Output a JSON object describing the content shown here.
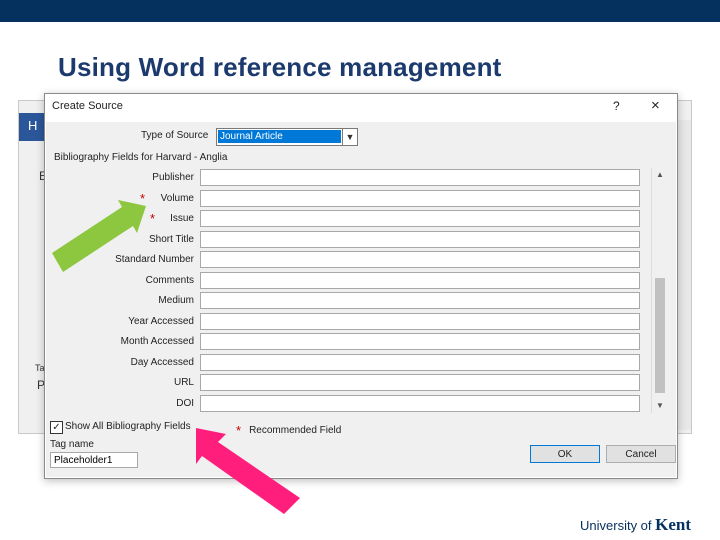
{
  "slide": {
    "title": "Using Word reference management",
    "logo_prefix": "University of",
    "logo_name": "Kent"
  },
  "background_window": {
    "tab_glyph": "H",
    "fragment_1": "E",
    "fragment_2": "P",
    "fragment_3": "Ta"
  },
  "dialog": {
    "title": "Create Source",
    "help": "?",
    "close": "×",
    "type_of_source_label": "Type of Source",
    "type_of_source_value": "Journal Article",
    "fields_heading": "Bibliography Fields for Harvard - Anglia",
    "fields": [
      {
        "label": "Publisher",
        "recommended": false
      },
      {
        "label": "Volume",
        "recommended": true
      },
      {
        "label": "Issue",
        "recommended": true
      },
      {
        "label": "Short Title",
        "recommended": false
      },
      {
        "label": "Standard Number",
        "recommended": false
      },
      {
        "label": "Comments",
        "recommended": false
      },
      {
        "label": "Medium",
        "recommended": false
      },
      {
        "label": "Year Accessed",
        "recommended": false
      },
      {
        "label": "Month Accessed",
        "recommended": false
      },
      {
        "label": "Day Accessed",
        "recommended": false
      },
      {
        "label": "URL",
        "recommended": false
      },
      {
        "label": "DOI",
        "recommended": false
      }
    ],
    "show_all_label": "Show All Bibliography Fields",
    "show_all_checked": true,
    "recommended_star": "*",
    "recommended_label": "Recommended Field",
    "tag_name_label": "Tag name",
    "tag_name_value": "Placeholder1",
    "ok_label": "OK",
    "cancel_label": "Cancel"
  },
  "colors": {
    "title": "#1d3a6e",
    "top_bar": "#05315f",
    "arrow_green": "#8dc63f",
    "arrow_pink": "#ff1e7c",
    "star": "#c00000"
  }
}
